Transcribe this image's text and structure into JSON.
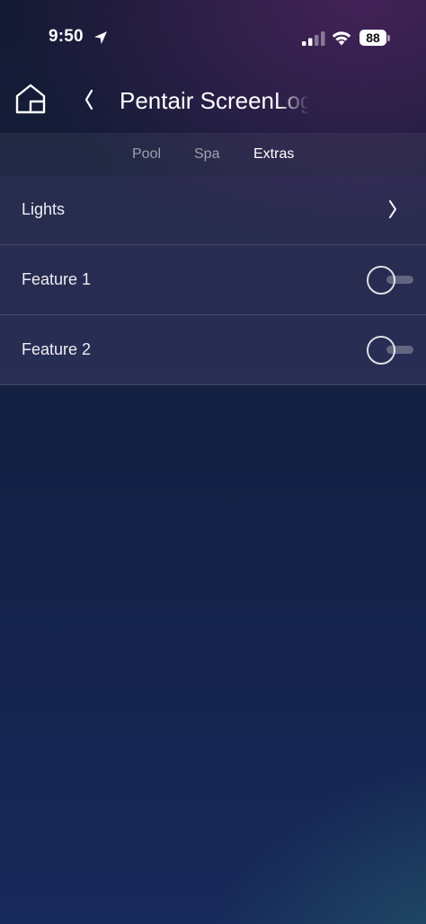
{
  "status_bar": {
    "time": "9:50",
    "battery": "88",
    "icons": [
      "location-arrow-icon",
      "cellular-signal-icon",
      "wifi-icon",
      "battery-icon"
    ]
  },
  "header": {
    "title": "Pentair ScreenLogic",
    "home_icon": "home-icon",
    "back_icon": "chevron-left-icon"
  },
  "tabs": [
    {
      "label": "Pool",
      "active": false
    },
    {
      "label": "Spa",
      "active": false
    },
    {
      "label": "Extras",
      "active": true
    }
  ],
  "list": {
    "items": [
      {
        "label": "Lights",
        "control": "chevron-right-icon"
      },
      {
        "label": "Feature 1",
        "control": "toggle",
        "on": false
      },
      {
        "label": "Feature 2",
        "control": "toggle",
        "on": false
      }
    ]
  },
  "colors": {
    "background_top": "#141a33",
    "background_bottom": "#17295a",
    "accent_teal": "#26646e",
    "accent_purple": "#46235a"
  }
}
